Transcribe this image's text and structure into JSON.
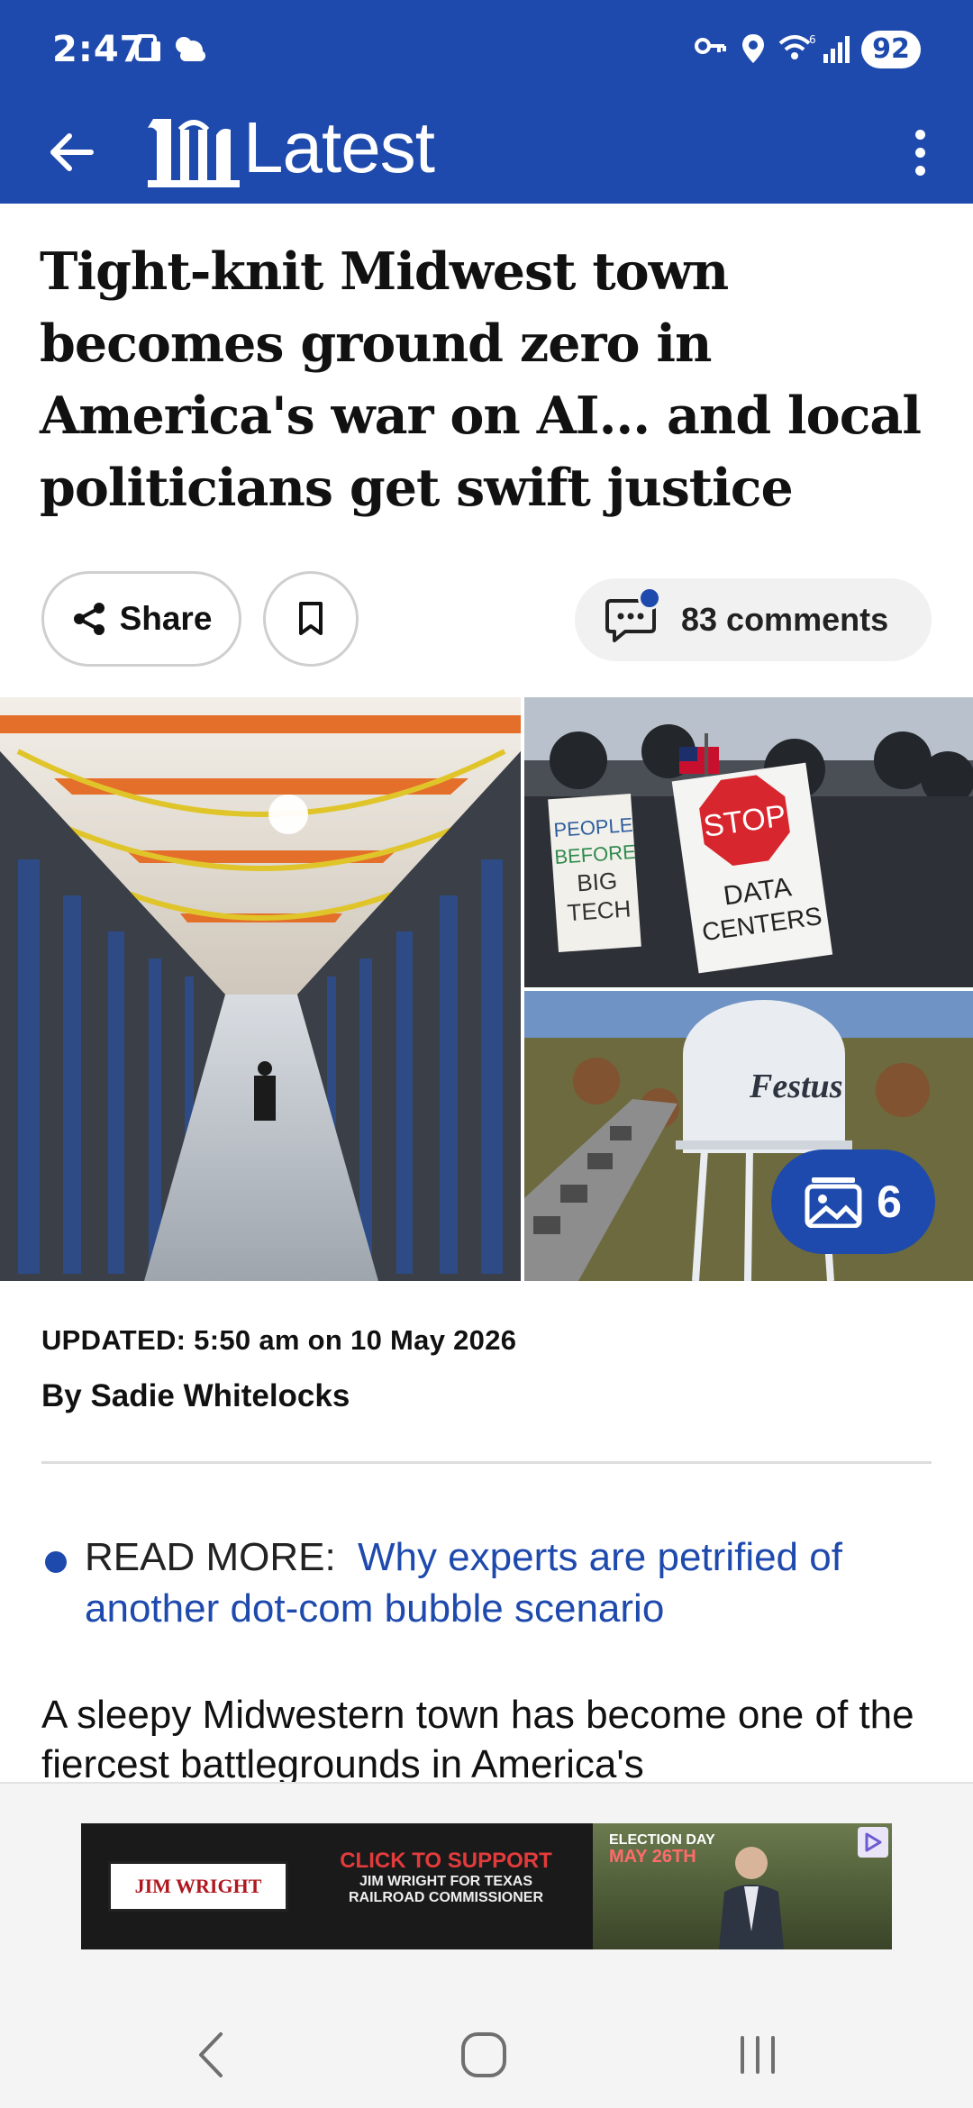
{
  "status_bar": {
    "time": "2:47",
    "battery": "92",
    "icons": [
      "calendar-icon",
      "weather-icon",
      "key-icon",
      "location-icon",
      "wifi-icon",
      "signal-icon"
    ]
  },
  "app_bar": {
    "title": "Latest",
    "logo": "daily-mail-logo",
    "accent_color": "#1f4aad"
  },
  "article": {
    "headline": "Tight-knit Midwest town becomes ground zero in America's war on AI... and local politicians get swift justice",
    "actions": {
      "share_label": "Share",
      "bookmark_icon": "bookmark-icon",
      "comments_label": "83 comments"
    },
    "gallery": {
      "count": "6",
      "images": [
        "data-center-corridor",
        "protest-signs",
        "festus-water-tower"
      ],
      "protest_sign_left": "PEOPLE BEFORE BIG TECH",
      "protest_sign_right_top": "STOP",
      "protest_sign_right_bottom": "DATA CENTERS",
      "water_tower_text": "Festus"
    },
    "updated": "UPDATED: 5:50 am on 10 May 2026",
    "byline": "By Sadie Whitelocks",
    "read_more": {
      "label": "READ MORE:",
      "link_text": "Why experts are petrified of another dot-com bubble scenario"
    },
    "body_preview": "A sleepy Midwestern town has become one of the fiercest battlegrounds in America's"
  },
  "ad": {
    "logo_text": "JIM WRIGHT",
    "cta": "CLICK TO SUPPORT",
    "subtext": "JIM WRIGHT FOR TEXAS RAILROAD COMMISSIONER",
    "date_label": "ELECTION DAY",
    "date_value": "MAY 26TH"
  },
  "nav_bar": {
    "buttons": [
      "back-nav",
      "home-nav",
      "recents-nav"
    ]
  }
}
